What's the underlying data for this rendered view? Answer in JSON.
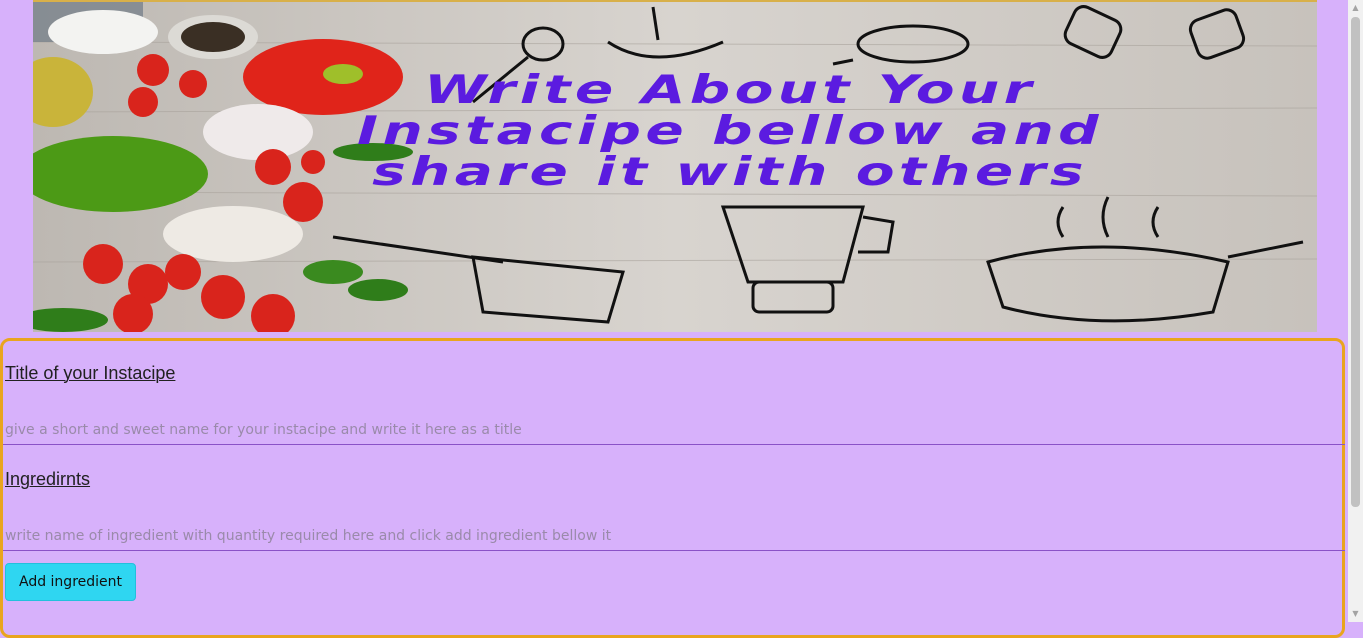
{
  "banner": {
    "line1": "Write About Your",
    "line2": "Instacipe bellow and",
    "line3": "share it with others"
  },
  "form": {
    "title_label": "Title of your Instacipe",
    "title_placeholder": "give a short and sweet name for your instacipe and write it here as a title",
    "ingredients_label": "Ingredirnts",
    "ingredient_placeholder": "write name of ingredient with quantity required here and click add ingredient bellow it",
    "add_button": "Add ingredient"
  },
  "colors": {
    "background": "#d7b1fb",
    "card_border": "#e9a51e",
    "button": "#2fd6f1",
    "banner_text": "#5b1be0"
  }
}
